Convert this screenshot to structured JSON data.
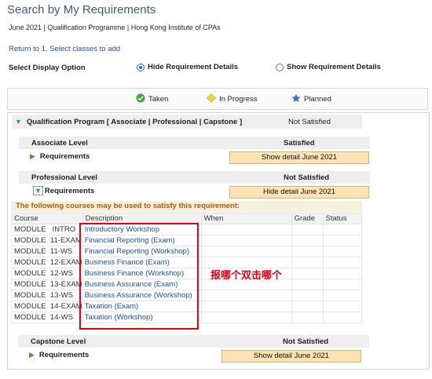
{
  "page": {
    "title": "Search by My Requirements",
    "subtitle": "June 2021 | Qualification Programme | Hong Kong Institute of CPAs",
    "return_link": "Return to 1. Select classes to add"
  },
  "display_option": {
    "label": "Select Display Option",
    "hide_label": "Hide Requirement Details",
    "show_label": "Show Requirement Details",
    "selected": "hide"
  },
  "legend": {
    "taken": "Taken",
    "in_progress": "In Progress",
    "planned": "Planned"
  },
  "program": {
    "title": "Qualification Program [ Associate | Professional | Capstone ]",
    "status": "Not Satisfied"
  },
  "associate": {
    "name": "Associate Level",
    "status": "Satisfied",
    "requirements_label": "Requirements",
    "button": "Show detail June 2021"
  },
  "professional": {
    "name": "Professional Level",
    "status": "Not Satisfied",
    "requirements_label": "Requirements",
    "button": "Hide detail June 2021",
    "courses_banner": "The following courses may be used to satisfy this requirement:",
    "columns": [
      "Course",
      "Description",
      "When",
      "Grade",
      "Status"
    ],
    "courses": [
      {
        "course": "MODULE   INTRO",
        "description": "Introductory Workshop"
      },
      {
        "course": "MODULE  11-EXAM",
        "description": "Financial Reporting (Exam)"
      },
      {
        "course": "MODULE  11-WS",
        "description": "Financial Reporting (Workshop)"
      },
      {
        "course": "MODULE  12-EXAM",
        "description": "Business Finance (Exam)"
      },
      {
        "course": "MODULE  12-WS",
        "description": "Business Finance (Workshop)"
      },
      {
        "course": "MODULE  13-EXAM",
        "description": "Business Assurance (Exam)"
      },
      {
        "course": "MODULE  13-WS",
        "description": "Business Assurance (Workshop)"
      },
      {
        "course": "MODULE  14-EXAM",
        "description": "Taxation (Exam)"
      },
      {
        "course": "MODULE  14-WS",
        "description": "Taxation (Workshop)"
      }
    ]
  },
  "capstone": {
    "name": "Capstone Level",
    "status": "Not Satisfied",
    "requirements_label": "Requirements",
    "button": "Show detail June 2021"
  },
  "annotation": {
    "text": "报哪个双击哪个",
    "color": "#e60012"
  },
  "colors": {
    "title": "#3b5c7a",
    "link": "#1f4fa0",
    "button_bg": "#fbe3b5",
    "banner_text": "#b55a00"
  }
}
